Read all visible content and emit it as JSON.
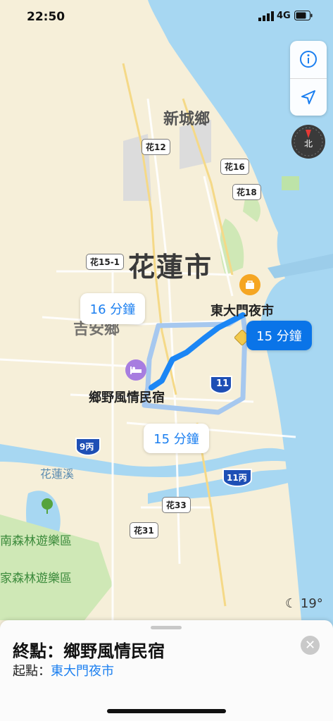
{
  "status": {
    "time": "22:50",
    "network": "4G"
  },
  "controls": {
    "info_icon": "info-icon",
    "locate_icon": "location-arrow-icon",
    "compass_label": "北"
  },
  "map": {
    "districts": [
      "新城鄉",
      "花蓮市",
      "吉安鄉"
    ],
    "routes": [
      "花12",
      "花16",
      "花18",
      "花15-1",
      "花33",
      "花31"
    ],
    "highways": [
      "11",
      "9丙",
      "11丙"
    ],
    "rivers": [
      "花蓮溪"
    ],
    "parks": [
      "南森林遊樂區",
      "家森林遊樂區"
    ],
    "places": {
      "origin": "東大門夜市",
      "destination": "鄉野風情民宿"
    }
  },
  "route_options": [
    {
      "label": "16 分鐘",
      "selected": false
    },
    {
      "label": "15 分鐘",
      "selected": true
    },
    {
      "label": "15 分鐘",
      "selected": false
    }
  ],
  "weather": {
    "temp": "19°"
  },
  "sheet": {
    "destination_prefix": "終點：",
    "destination": "鄉野風情民宿",
    "origin_prefix": "起點：",
    "origin": "東大門夜市"
  },
  "colors": {
    "sea": "#a7d7f2",
    "route_selected": "#1b86f5",
    "route_alt": "#a6c8ef",
    "land": "#f6efd9",
    "green": "#bfe2a7"
  }
}
